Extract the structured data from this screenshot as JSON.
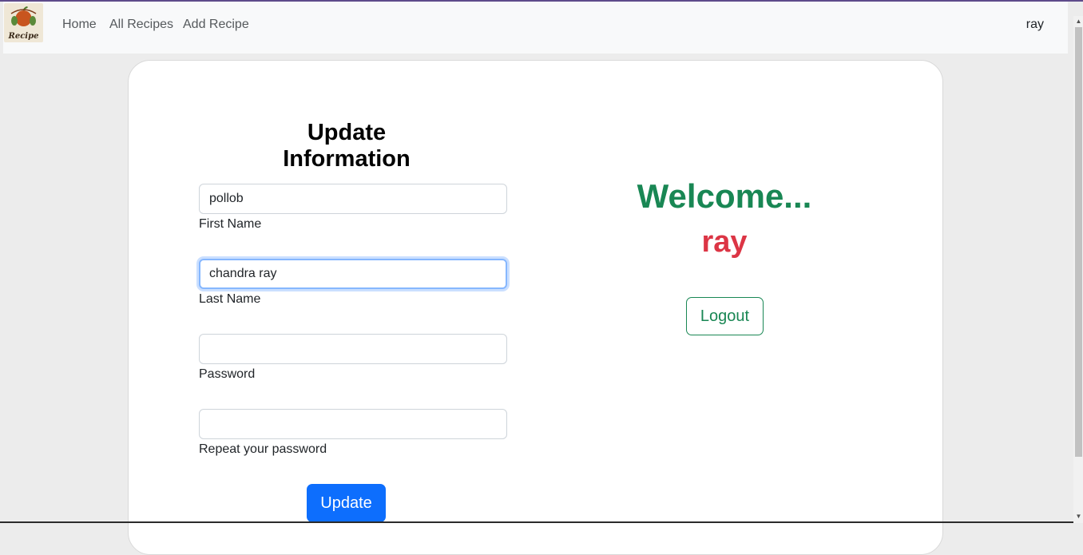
{
  "nav": {
    "logo_alt": "Recipe",
    "links": [
      "Home",
      "All Recipes",
      "Add Recipe"
    ],
    "user": "ray"
  },
  "form": {
    "title": "Update Information",
    "first_name": {
      "value": "pollob",
      "label": "First Name"
    },
    "last_name": {
      "value": "chandra ray",
      "label": "Last Name"
    },
    "password": {
      "value": "",
      "label": "Password"
    },
    "repeat_password": {
      "value": "",
      "label": "Repeat your password"
    },
    "submit_label": "Update"
  },
  "welcome": {
    "greeting": "Welcome...",
    "name": "ray",
    "logout_label": "Logout"
  },
  "colors": {
    "primary": "#0d6efd",
    "success": "#198754",
    "danger": "#dc3545"
  }
}
